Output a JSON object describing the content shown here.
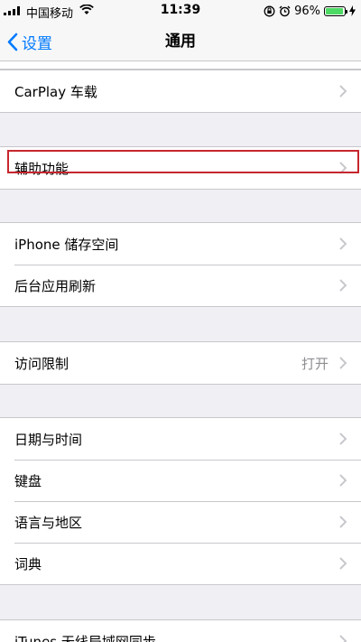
{
  "status_bar": {
    "carrier": "中国移动",
    "time": "11:39",
    "battery": "96%",
    "battery_level": 0.96
  },
  "nav": {
    "back_label": "设置",
    "title": "通用"
  },
  "rows": {
    "carplay": "CarPlay 车载",
    "accessibility": "辅助功能",
    "iphone_storage": "iPhone 储存空间",
    "background_refresh": "后台应用刷新",
    "restrictions": "访问限制",
    "restrictions_value": "打开",
    "date_time": "日期与时间",
    "keyboard": "键盘",
    "language_region": "语言与地区",
    "dictionary": "词典",
    "itunes_wifi_sync": "iTunes 无线局域网同步"
  },
  "colors": {
    "accent": "#007aff",
    "highlight_border": "#c6262e",
    "battery_green": "#4cd964"
  }
}
